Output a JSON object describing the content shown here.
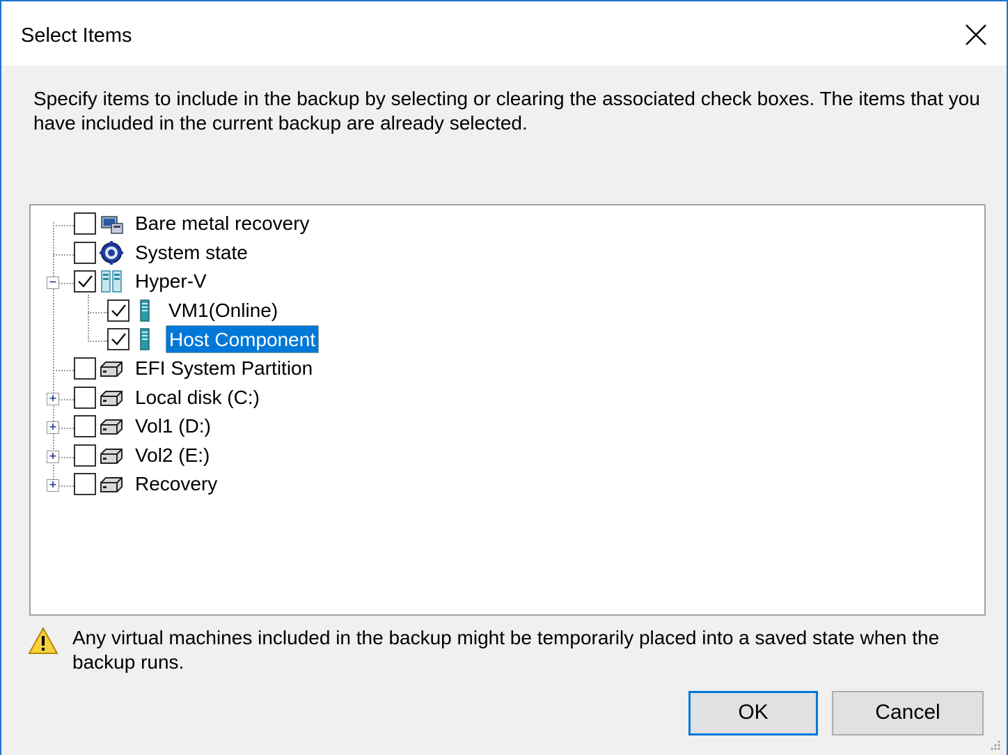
{
  "window": {
    "title": "Select Items",
    "close_label": "×"
  },
  "instructions": "Specify items to include in the backup by selecting or clearing the associated check boxes. The items that you have included in the current backup are already selected.",
  "tree": {
    "items": [
      {
        "label": "Bare metal recovery",
        "checked": false,
        "icon": "bare-metal-icon",
        "expander": null,
        "level": 0
      },
      {
        "label": "System state",
        "checked": false,
        "icon": "system-state-icon",
        "expander": null,
        "level": 0
      },
      {
        "label": "Hyper-V",
        "checked": true,
        "icon": "hyperv-icon",
        "expander": "collapse",
        "level": 0
      },
      {
        "label": "VM1(Online)",
        "checked": true,
        "icon": "vm-icon",
        "expander": null,
        "level": 1
      },
      {
        "label": "Host Component",
        "checked": true,
        "icon": "vm-icon",
        "expander": null,
        "level": 1,
        "selected": true
      },
      {
        "label": "EFI System Partition",
        "checked": false,
        "icon": "disk-icon",
        "expander": null,
        "level": 0
      },
      {
        "label": "Local disk (C:)",
        "checked": false,
        "icon": "disk-icon",
        "expander": "expand",
        "level": 0
      },
      {
        "label": "Vol1 (D:)",
        "checked": false,
        "icon": "disk-icon",
        "expander": "expand",
        "level": 0
      },
      {
        "label": "Vol2 (E:)",
        "checked": false,
        "icon": "disk-icon",
        "expander": "expand",
        "level": 0
      },
      {
        "label": "Recovery",
        "checked": false,
        "icon": "disk-icon",
        "expander": "expand",
        "level": 0
      }
    ]
  },
  "warning": {
    "icon": "warning-icon",
    "text": "Any virtual machines included in the backup might be temporarily placed into a saved state when the backup runs."
  },
  "buttons": {
    "ok": "OK",
    "cancel": "Cancel"
  },
  "colors": {
    "accent": "#0078d7",
    "window_border": "#1e73d2",
    "selection_bg": "#0078d7"
  }
}
